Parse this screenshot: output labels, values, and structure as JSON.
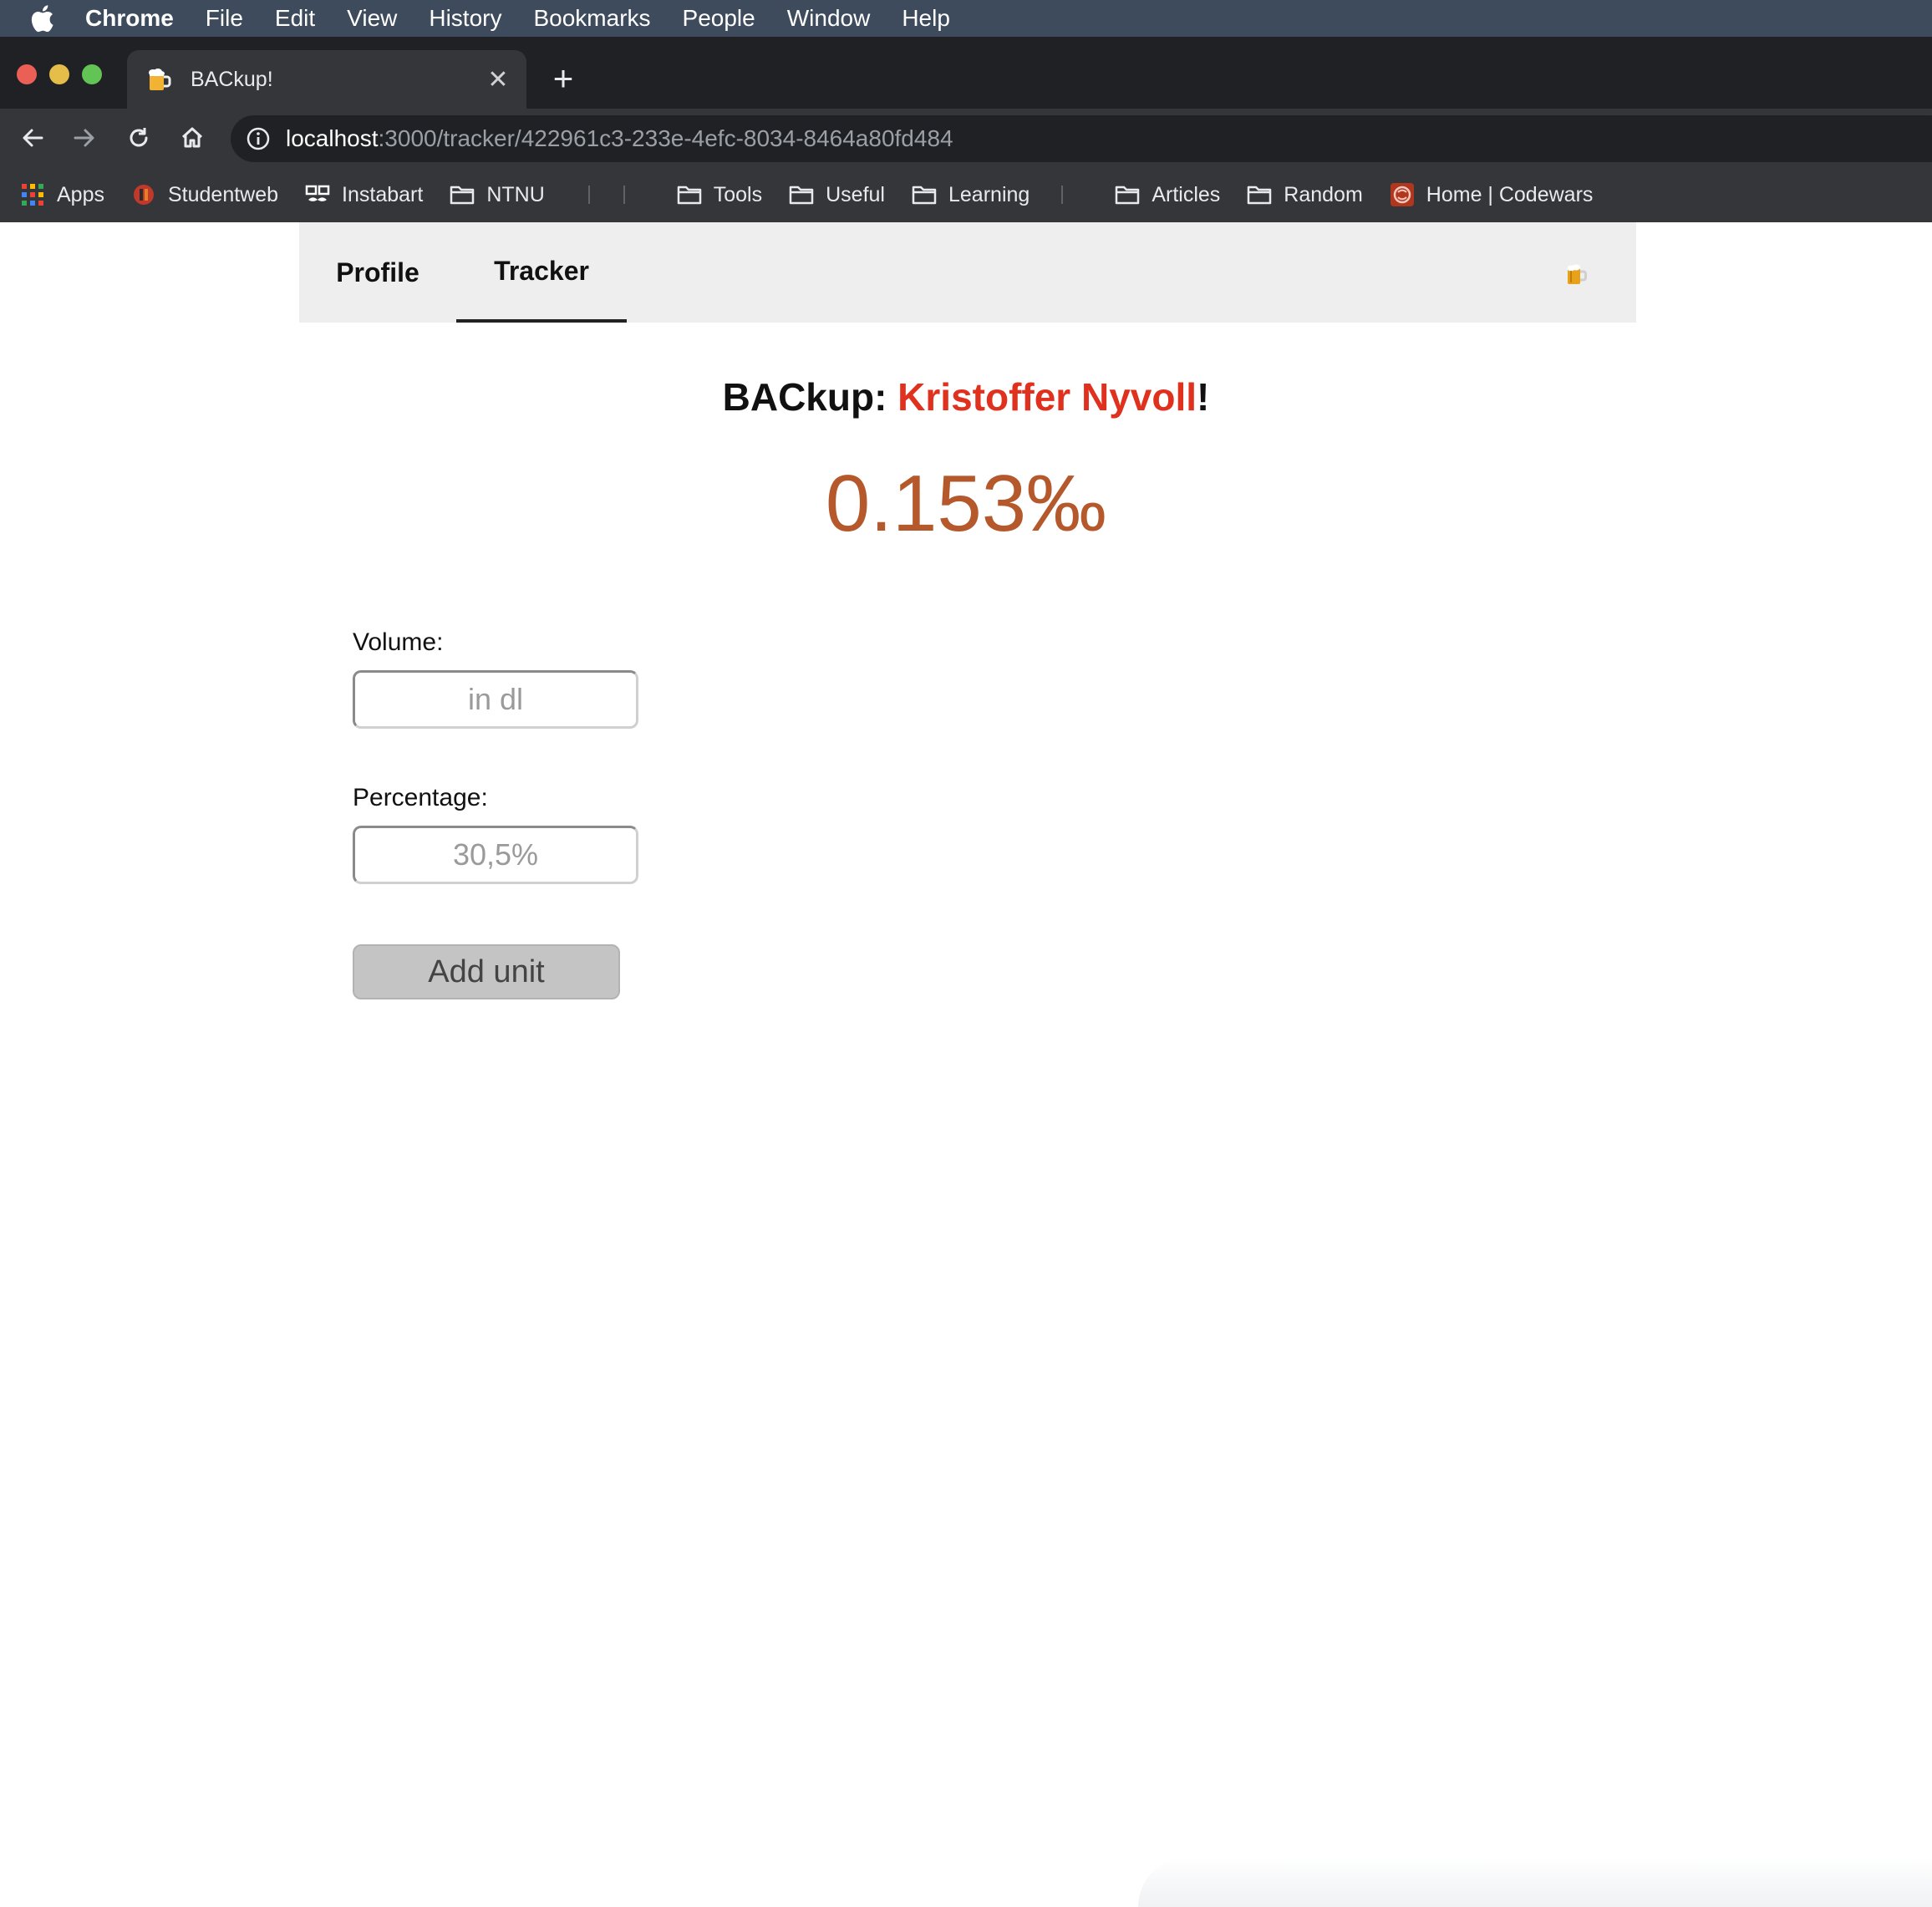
{
  "menubar": {
    "app_name": "Chrome",
    "items": [
      "File",
      "Edit",
      "View",
      "History",
      "Bookmarks",
      "People",
      "Window",
      "Help"
    ]
  },
  "tab": {
    "title": "BACkup!",
    "close_glyph": "✕",
    "new_tab_glyph": "+"
  },
  "omnibox": {
    "host": "localhost",
    "path": ":3000/tracker/422961c3-233e-4efc-8034-8464a80fd484"
  },
  "bookmarks": {
    "items": [
      "Apps",
      "Studentweb",
      "Instabart",
      "NTNU",
      "Tools",
      "Useful",
      "Learning",
      "Articles",
      "Random",
      "Home | Codewars"
    ]
  },
  "nav": {
    "profile": "Profile",
    "tracker": "Tracker"
  },
  "headline": {
    "prefix": "BACkup: ",
    "name": "Kristoffer Nyvoll",
    "suffix": "!"
  },
  "bac": {
    "value": "0.153‰"
  },
  "form": {
    "volume_label": "Volume:",
    "volume_placeholder": "in dl",
    "percentage_label": "Percentage:",
    "percentage_placeholder": "30,5%",
    "submit_label": "Add unit"
  },
  "colors": {
    "name_red": "#e0301e",
    "bac_brown": "#b5582c"
  }
}
